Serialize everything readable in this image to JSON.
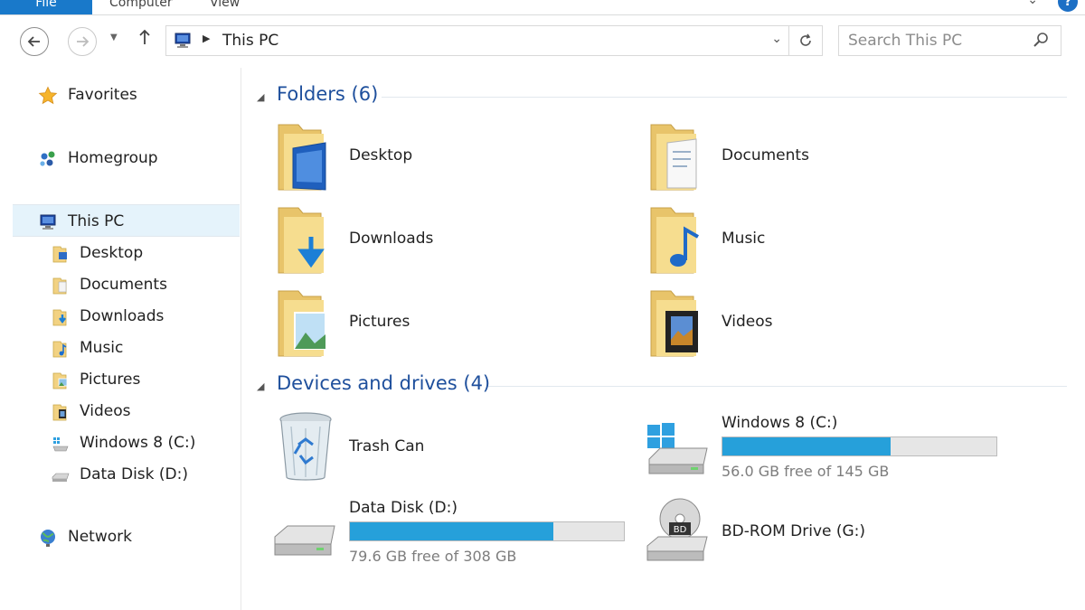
{
  "ribbon": {
    "tabs": [
      "File",
      "Computer",
      "View"
    ]
  },
  "address": {
    "path": "This PC"
  },
  "search": {
    "placeholder": "Search This PC"
  },
  "nav_pane": {
    "favorites": "Favorites",
    "homegroup": "Homegroup",
    "this_pc": "This PC",
    "this_pc_children": [
      "Desktop",
      "Documents",
      "Downloads",
      "Music",
      "Pictures",
      "Videos",
      "Windows 8 (C:)",
      "Data Disk (D:)"
    ],
    "network": "Network"
  },
  "folders_group": {
    "title": "Folders (6)",
    "items": [
      "Desktop",
      "Documents",
      "Downloads",
      "Music",
      "Pictures",
      "Videos"
    ]
  },
  "devices_group": {
    "title": "Devices and drives (4)",
    "items": [
      {
        "name": "Trash Can"
      },
      {
        "name": "Windows 8 (C:)",
        "free_text": "56.0 GB free of 145 GB",
        "used_fraction": 0.614
      },
      {
        "name": "Data Disk (D:)",
        "free_text": "79.6 GB free of 308 GB",
        "used_fraction": 0.742
      },
      {
        "name": "BD-ROM Drive (G:)"
      }
    ]
  },
  "colors": {
    "accent": "#1979ca",
    "group_title": "#1e4f9c",
    "selection": "#e5f3fb",
    "bar_fill": "#26a0da",
    "folder": "#f2d282"
  },
  "icons": {
    "nav_favorites": "star-icon",
    "nav_homegroup": "homegroup-icon",
    "nav_this_pc": "computer-icon",
    "nav_network": "network-globe-icon",
    "trash": "recycle-bin-icon",
    "bd_rom": "bd-rom-drive-icon"
  }
}
